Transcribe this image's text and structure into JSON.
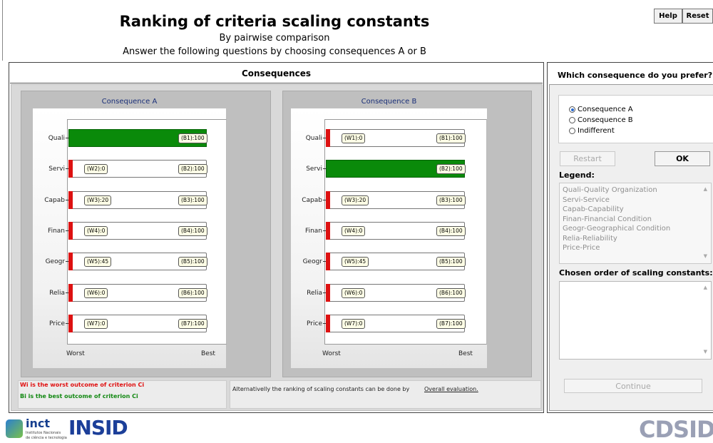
{
  "header": {
    "title": "Ranking of criteria scaling constants",
    "subtitle": "By pairwise comparison",
    "instruction": "Answer the following questions by choosing consequences A or B"
  },
  "top_buttons": {
    "help": "Help",
    "reset": "Reset"
  },
  "main": {
    "heading": "Consequences",
    "axis_worst": "Worst",
    "axis_best": "Best",
    "consequence_a": {
      "title": "Consequence A",
      "rows": [
        {
          "criterion": "Quali",
          "best_label": "(B1):100",
          "level": 1.0
        },
        {
          "criterion": "Servi",
          "worst_label": "(W2):0",
          "best_label": "(B2):100",
          "level": 0.0
        },
        {
          "criterion": "Capab",
          "worst_label": "(W3):20",
          "best_label": "(B3):100",
          "level": 0.0
        },
        {
          "criterion": "Finan",
          "worst_label": "(W4):0",
          "best_label": "(B4):100",
          "level": 0.0
        },
        {
          "criterion": "Geogr",
          "worst_label": "(W5):45",
          "best_label": "(B5):100",
          "level": 0.0
        },
        {
          "criterion": "Relia",
          "worst_label": "(W6):0",
          "best_label": "(B6):100",
          "level": 0.0
        },
        {
          "criterion": "Price",
          "worst_label": "(W7):0",
          "best_label": "(B7):100",
          "level": 0.0
        }
      ]
    },
    "consequence_b": {
      "title": "Consequence B",
      "rows": [
        {
          "criterion": "Quali",
          "worst_label": "(W1):0",
          "best_label": "(B1):100",
          "level": 0.0
        },
        {
          "criterion": "Servi",
          "best_label": "(B2):100",
          "level": 1.0
        },
        {
          "criterion": "Capab",
          "worst_label": "(W3):20",
          "best_label": "(B3):100",
          "level": 0.0
        },
        {
          "criterion": "Finan",
          "worst_label": "(W4):0",
          "best_label": "(B4):100",
          "level": 0.0
        },
        {
          "criterion": "Geogr",
          "worst_label": "(W5):45",
          "best_label": "(B5):100",
          "level": 0.0
        },
        {
          "criterion": "Relia",
          "worst_label": "(W6):0",
          "best_label": "(B6):100",
          "level": 0.0
        },
        {
          "criterion": "Price",
          "worst_label": "(W7):0",
          "best_label": "(B7):100",
          "level": 0.0
        }
      ]
    },
    "note_worst": "Wi is the worst outcome of criterion Ci",
    "note_best": "Bi is the best outcome of criterion Ci",
    "alternative_text": "Alternativelly the ranking of scaling constants can be done by",
    "alternative_link": "Overall evaluation."
  },
  "side": {
    "question": "Which consequence do you prefer?",
    "options": [
      {
        "label": "Consequence A",
        "selected": true
      },
      {
        "label": "Consequence B",
        "selected": false
      },
      {
        "label": "Indifferent",
        "selected": false
      }
    ],
    "restart_label": "Restart",
    "ok_label": "OK",
    "legend_title": "Legend:",
    "legend_items": [
      "Quali-Quality Organization",
      "Servi-Service",
      "Capab-Capability",
      "Finan-Financial Condition",
      "Geogr-Geographical Condition",
      "Relia-Reliability",
      "Price-Price"
    ],
    "chosen_title": "Chosen order of scaling constants:",
    "continue_label": "Continue"
  },
  "footer": {
    "inct_text": "inct",
    "inct_sub1": "Institutos Nacionais",
    "inct_sub2": "de ciência e tecnologia",
    "insid_text": "INSID",
    "cdsid_text": "CDSID"
  },
  "colors": {
    "best_bar": "#0a8a0a",
    "worst_marker": "#dd1111",
    "chart_title": "#1a2f78",
    "selected_radio": "#2a6bd1"
  }
}
